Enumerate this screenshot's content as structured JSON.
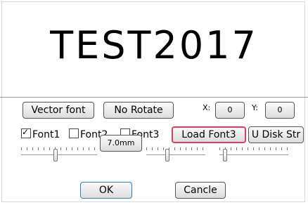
{
  "preview": {
    "text": "TEST2017"
  },
  "controls": {
    "vector_font_label": "Vector font",
    "rotate_label": "No Rotate",
    "x_label": "X:",
    "x_value": "0",
    "y_label": "Y:",
    "y_value": "0",
    "font1_label": "Font1",
    "font1_checked": true,
    "font2_label": "Font2",
    "font2_checked": false,
    "font3_label": "Font3",
    "font3_checked": false,
    "load_font3_label": "Load Font3",
    "udisk_label": "U Disk Str",
    "size_label": "7.0mm",
    "slider1_level": 0.45,
    "slider2_level": 0.35,
    "slider3_level": 0.05
  },
  "actions": {
    "ok_label": "OK",
    "cancel_label": "Cancle"
  },
  "colors": {
    "highlight": "#d7415f",
    "ok_border": "#2f7fbf"
  }
}
